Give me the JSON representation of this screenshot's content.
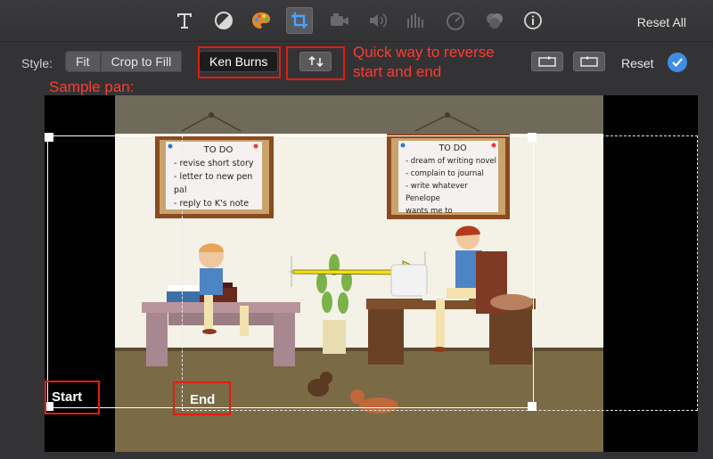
{
  "toolbar": {
    "icons": [
      "text-icon",
      "color-balance-icon",
      "color-palette-icon",
      "crop-icon",
      "camera-icon",
      "volume-icon",
      "equalizer-icon",
      "speedometer-icon",
      "overlay-icon",
      "info-icon"
    ],
    "reset_all_label": "Reset All"
  },
  "style_row": {
    "label": "Style:",
    "buttons": [
      "Fit",
      "Crop to Fill",
      "Ken Burns"
    ],
    "selected": "Ken Burns",
    "reset_label": "Reset"
  },
  "annotations": {
    "swap_note": [
      "Quick way to reverse",
      "start and end"
    ],
    "sample_pan": "Sample pan:"
  },
  "viewer": {
    "start_label": "Start",
    "end_label": "End",
    "notes_left": {
      "title": "TO DO",
      "lines": [
        "- revise short story",
        "- letter to new pen pal",
        "- reply to K's note"
      ]
    },
    "notes_right": {
      "title": "TO DO",
      "lines": [
        "- dream of writing novel",
        "- complain to journal",
        "- write whatever Penelope",
        "wants me to"
      ]
    }
  },
  "colors": {
    "accent_blue": "#3e8ee6",
    "annotation_red": "#ff3b30",
    "arrow_yellow": "#f2e10f"
  }
}
